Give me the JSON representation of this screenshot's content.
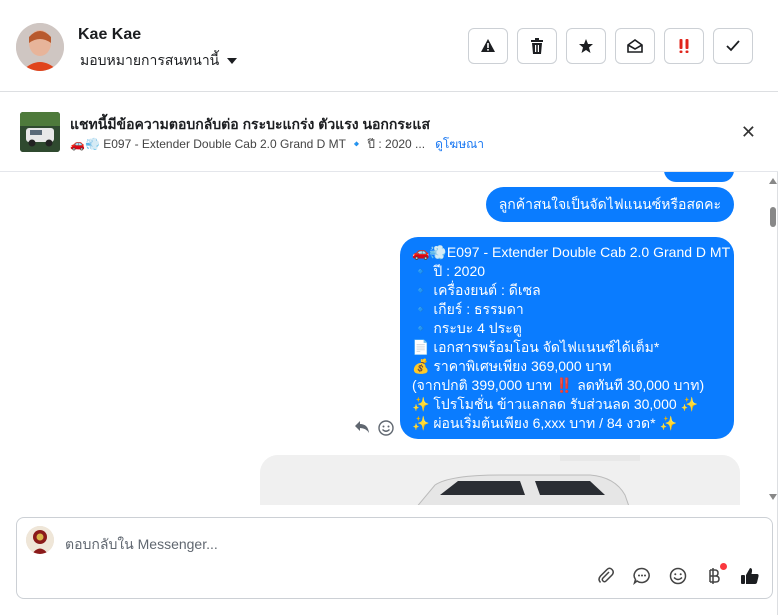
{
  "header": {
    "name": "Kae Kae",
    "assign_label": "มอบหมายการสนทนานี้",
    "actions": [
      {
        "name": "report-spam-button",
        "glyph": "⚠"
      },
      {
        "name": "delete-button",
        "glyph": "🗑"
      },
      {
        "name": "star-button",
        "glyph": "★"
      },
      {
        "name": "mark-unread-button",
        "glyph": "✉"
      },
      {
        "name": "follow-up-button",
        "glyph": "!!"
      },
      {
        "name": "mark-done-button",
        "glyph": "✓"
      }
    ]
  },
  "ad": {
    "title": "แชทนี้มีข้อความตอบกลับต่อ กระบะแกร่ง ตัวแรง นอกกระแส",
    "subtitle": "🚗💨 E097 - Extender Double Cab 2.0 Grand D MT  🔹 ปี : 2020 ...",
    "link": "ดูโฆษณา",
    "close": "✕"
  },
  "messages": {
    "msg1": "ลูกค้าสนใจเป็นจัดไฟแนนซ์หรือสดคะ",
    "msg2_lines": [
      "🚗💨E097 - Extender Double Cab 2.0 Grand D MT",
      "🔹 ปี : 2020",
      "🔹 เครื่องยนต์ : ดีเซล",
      "🔹 เกียร์ : ธรรมดา",
      "🔹 กระบะ 4 ประตู",
      "📄 เอกสารพร้อมโอน จัดไฟแนนซ์ได้เต็ม*",
      "💰 ราคาพิเศษเพียง 369,000 บาท",
      "(จากปกติ 399,000 บาท ‼️ ลดทันที 30,000 บาท)",
      "✨ โปรโมชั่น ข้าวแลกลด รับส่วนลด 30,000 ✨",
      "✨ ผ่อนเริ่มต้นเพียง 6,xxx บาท / 84 งวด* ✨"
    ]
  },
  "composer": {
    "placeholder": "ตอบกลับใน Messenger..."
  },
  "colors": {
    "bubble": "#0a7cff",
    "accent": "#1877f2"
  }
}
